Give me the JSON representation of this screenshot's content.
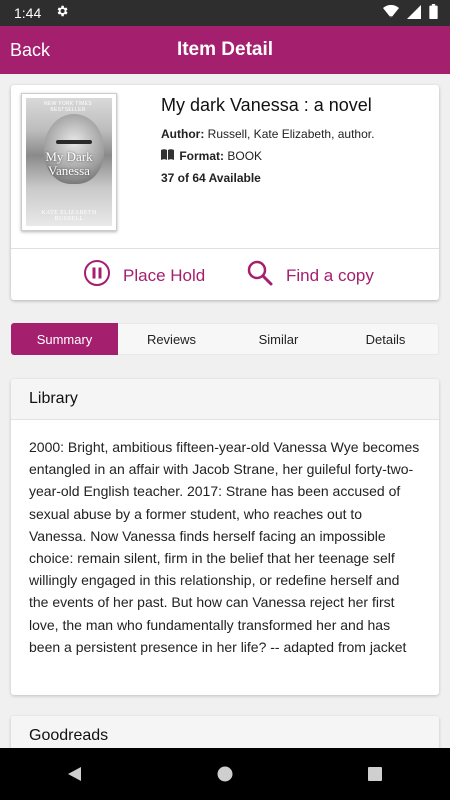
{
  "status_bar": {
    "time": "1:44",
    "icons": [
      "gear-icon",
      "wifi-icon",
      "signal-icon",
      "battery-icon"
    ]
  },
  "app_bar": {
    "back_label": "Back",
    "title": "Item Detail",
    "color": "#a51f6f"
  },
  "item": {
    "title": "My dark Vanessa : a novel",
    "author_label": "Author:",
    "author": "Russell, Kate Elizabeth, author.",
    "format_label": "Format:",
    "format": "BOOK",
    "availability": "37 of 64 Available",
    "cover": {
      "tagline": "NEW YORK TIMES BESTSELLER",
      "line1": "My Dark",
      "line2": "Vanessa",
      "author": "KATE ELIZABETH RUSSELL"
    }
  },
  "actions": {
    "place_hold": "Place Hold",
    "find_copy": "Find a copy"
  },
  "tabs": [
    {
      "label": "Summary",
      "active": true
    },
    {
      "label": "Reviews",
      "active": false
    },
    {
      "label": "Similar",
      "active": false
    },
    {
      "label": "Details",
      "active": false
    }
  ],
  "library": {
    "heading": "Library",
    "summary": "2000: Bright, ambitious fifteen-year-old Vanessa Wye becomes entangled in an affair with Jacob Strane, her guileful forty-two-year-old English teacher. 2017: Strane has been accused of sexual abuse by a former student, who reaches out to Vanessa. Now Vanessa finds herself facing an impossible choice: remain silent, firm in the belief that her teenage self willingly engaged in this relationship, or redefine herself and the events of her past. But how can Vanessa reject her first love, the man who fundamentally transformed her and has been a persistent presence in her life? -- adapted from jacket"
  },
  "goodreads": {
    "heading": "Goodreads"
  },
  "nav_bar": {
    "icons": [
      "back-triangle-icon",
      "home-circle-icon",
      "recents-square-icon"
    ]
  }
}
